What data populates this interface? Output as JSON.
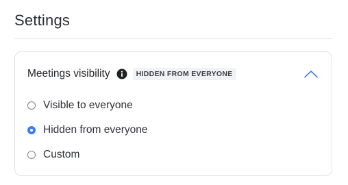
{
  "page": {
    "title": "Settings"
  },
  "section": {
    "title": "Meetings visibility",
    "info_icon": "info-circle-icon",
    "badge": "HIDDEN FROM EVERYONE",
    "collapse_icon": "chevron-up-icon",
    "expanded": true
  },
  "options": [
    {
      "label": "Visible to everyone",
      "selected": false
    },
    {
      "label": "Hidden from everyone",
      "selected": true
    },
    {
      "label": "Custom",
      "selected": false
    }
  ],
  "colors": {
    "accent": "#3d7cf0",
    "text": "#24262a",
    "border": "#dfe1e5",
    "badge_bg": "#f1f2f4"
  }
}
